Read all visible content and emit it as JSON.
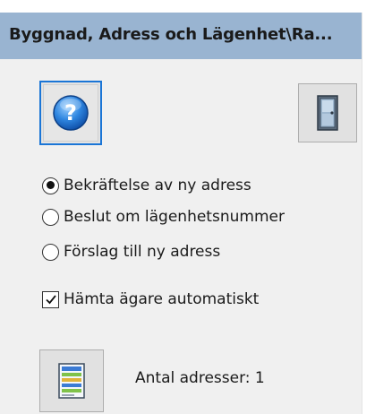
{
  "panel": {
    "title": "Byggnad, Adress och Lägenhet\\Ra..."
  },
  "buttons": {
    "help_icon": "help-question-icon",
    "exit_icon": "door-exit-icon",
    "list_icon": "address-list-icon"
  },
  "options": [
    {
      "label": "Bekräftelse av ny adress",
      "selected": true
    },
    {
      "label": "Beslut om lägenhetsnummer",
      "selected": false
    },
    {
      "label": "Förslag till ny adress",
      "selected": false
    }
  ],
  "auto_owner": {
    "label": "Hämta ägare automatiskt",
    "checked": true
  },
  "address_count": {
    "text": "Antal adresser: 1"
  },
  "colors": {
    "title_bar": "#99b4d1",
    "panel_bg": "#f0f0f0",
    "focus_border": "#1a75d6"
  }
}
